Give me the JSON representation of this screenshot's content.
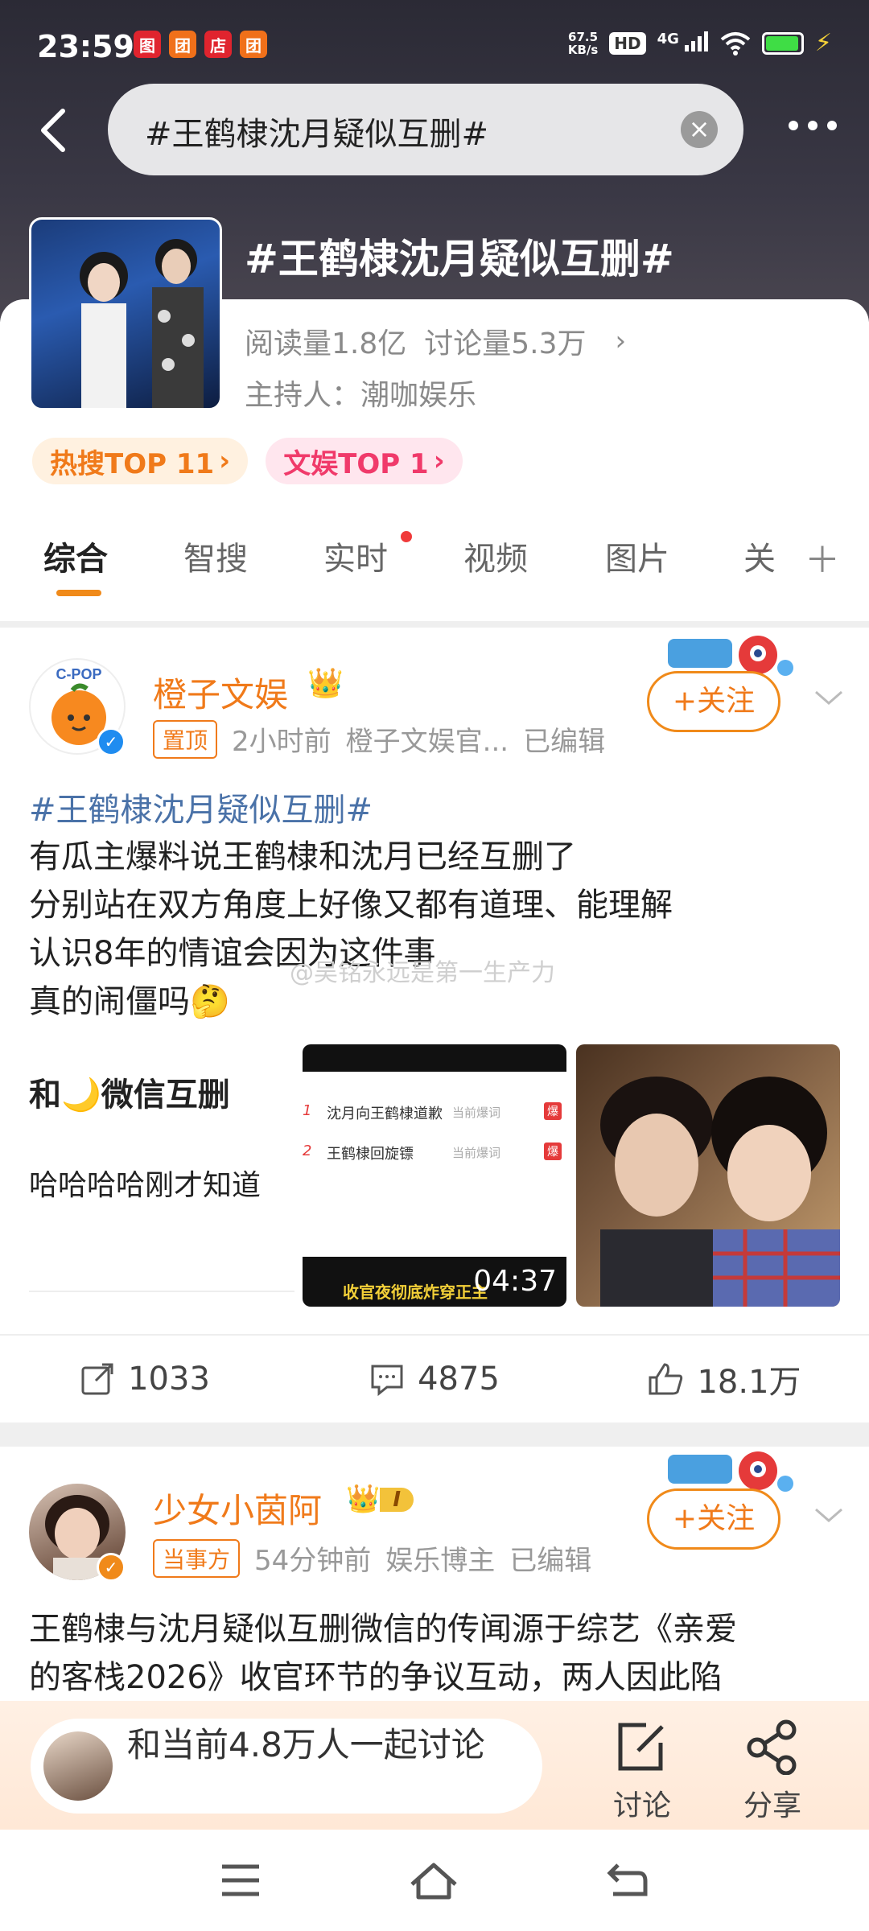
{
  "status_bar": {
    "time": "23:59",
    "notif_icons": [
      "图",
      "团",
      "店",
      "团"
    ],
    "net_speed_value": "67.5",
    "net_speed_unit": "KB/s",
    "hd": "HD",
    "network": "4G"
  },
  "search": {
    "query": "#王鹤棣沈月疑似互删#"
  },
  "topic": {
    "title": "#王鹤棣沈月疑似互删#",
    "reads": "阅读量1.8亿",
    "discussions": "讨论量5.3万",
    "host": "主持人：潮咖娱乐",
    "tags": [
      "热搜TOP 11",
      "文娱TOP 1"
    ]
  },
  "tabs": [
    "综合",
    "智搜",
    "实时",
    "视频",
    "图片",
    "关"
  ],
  "posts": [
    {
      "username": "橙子文娱",
      "avatar_text": "C-POP",
      "pinned": "置顶",
      "time": "2小时前",
      "source": "橙子文娱官...",
      "edited": "已编辑",
      "follow": "+关注",
      "hashtag": "#王鹤棣沈月疑似互删#",
      "lines": [
        "有瓜主爆料说王鹤棣和沈月已经互删了",
        "分别站在双方角度上好像又都有道理、能理解",
        "认识8年的情谊会因为这件事",
        "真的闹僵吗🤔"
      ],
      "watermark": "@吴铭永远是第一生产力",
      "image1_lines": [
        "和🌙微信互删",
        "哈哈哈哈刚才知道"
      ],
      "image2_items": [
        {
          "rank": "1",
          "text": "沈月向王鹤棣道歉",
          "note": "当前爆词",
          "badge": "爆"
        },
        {
          "rank": "2",
          "text": "王鹤棣回旋镖",
          "note": "当前爆词",
          "badge": "爆"
        }
      ],
      "image2_caption": "收官夜彻底炸穿正主",
      "image2_duration": "04:37",
      "reposts": "1033",
      "comments": "4875",
      "likes": "18.1万"
    },
    {
      "username": "少女小茵阿",
      "level_badge": "I",
      "role": "当事方",
      "time": "54分钟前",
      "source": "娱乐博主",
      "edited": "已编辑",
      "follow": "+关注",
      "lines": [
        "王鹤棣与沈月疑似互删微信的传闻源于综艺《亲爱",
        "的客栈2026》收官环节的争议互动，两人因此陷"
      ]
    }
  ],
  "bottom": {
    "join_text": "和当前4.8万人一起讨论",
    "discuss": "讨论",
    "share": "分享"
  },
  "colors": {
    "accent": "#f07a1a",
    "link": "#4a72a8",
    "hot": "#f03a6a"
  }
}
